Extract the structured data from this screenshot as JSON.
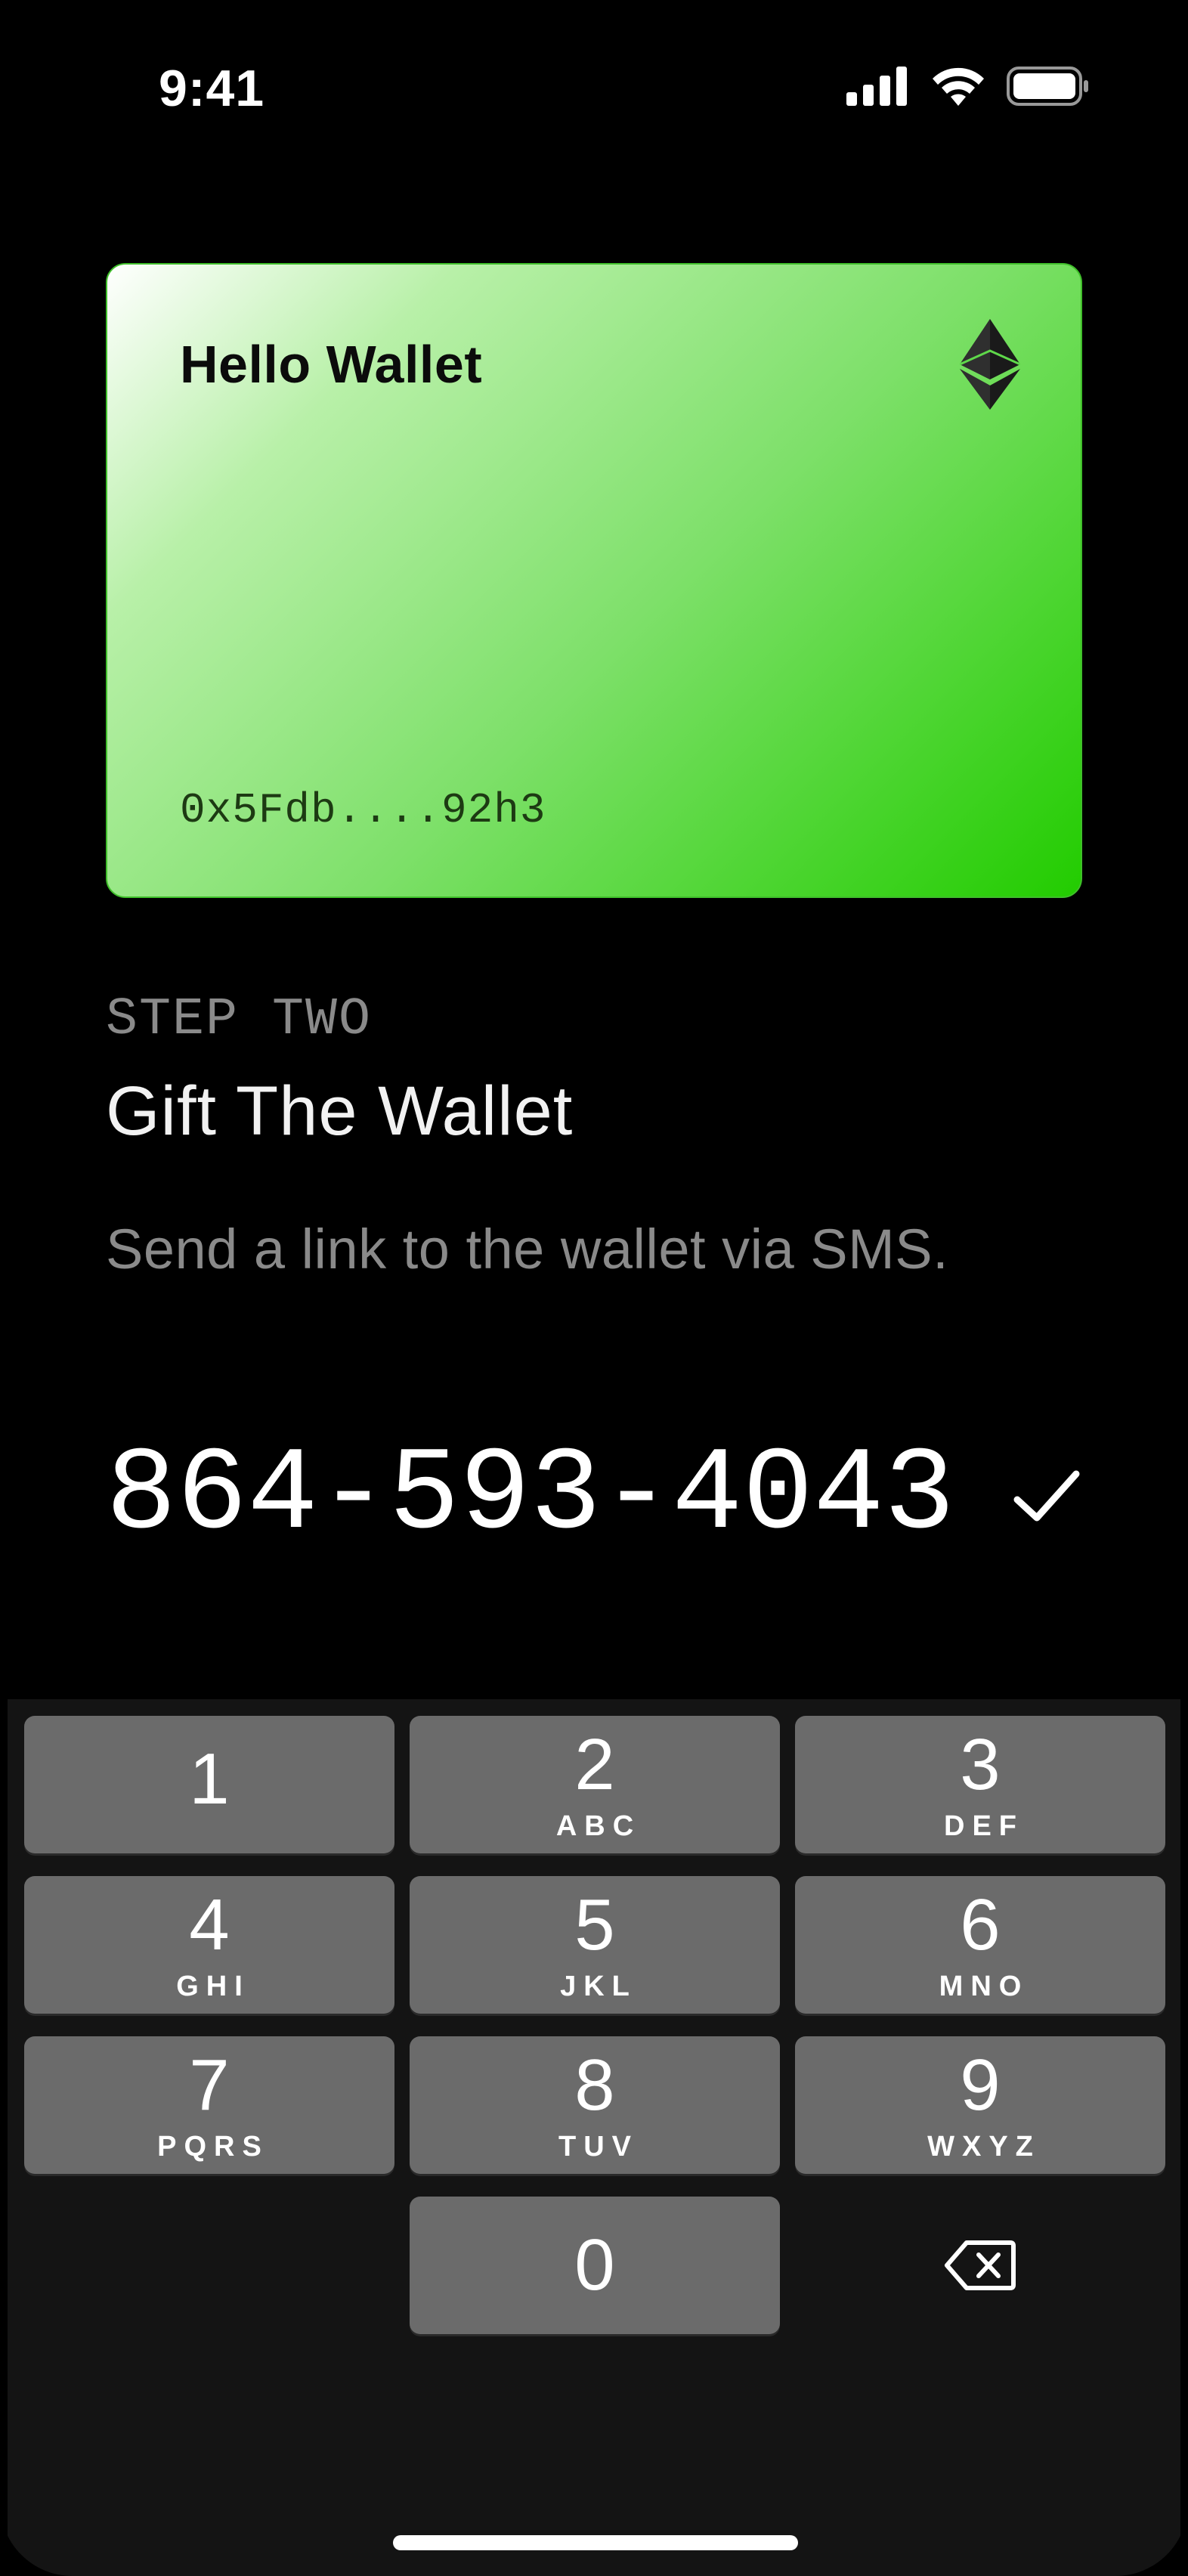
{
  "status_bar": {
    "time": "9:41",
    "signal_icon": "cellular-signal-icon",
    "wifi_icon": "wifi-icon",
    "battery_icon": "battery-icon"
  },
  "card": {
    "title": "Hello Wallet",
    "address": "0x5Fdb....92h3",
    "network_icon": "ethereum-icon",
    "colors": {
      "gradient_start": "#ffffff",
      "gradient_end": "#22cc00"
    }
  },
  "step": {
    "label": "STEP TWO",
    "title": "Gift The Wallet",
    "description": "Send a link to the wallet via SMS."
  },
  "phone_input": {
    "value": "864-593-4043",
    "confirm_icon": "checkmark-icon"
  },
  "keypad": {
    "keys": [
      {
        "digit": "1",
        "letters": ""
      },
      {
        "digit": "2",
        "letters": "ABC"
      },
      {
        "digit": "3",
        "letters": "DEF"
      },
      {
        "digit": "4",
        "letters": "GHI"
      },
      {
        "digit": "5",
        "letters": "JKL"
      },
      {
        "digit": "6",
        "letters": "MNO"
      },
      {
        "digit": "7",
        "letters": "PQRS"
      },
      {
        "digit": "8",
        "letters": "TUV"
      },
      {
        "digit": "9",
        "letters": "WXYZ"
      },
      {
        "digit": "0",
        "letters": ""
      }
    ],
    "backspace_icon": "backspace-icon"
  }
}
